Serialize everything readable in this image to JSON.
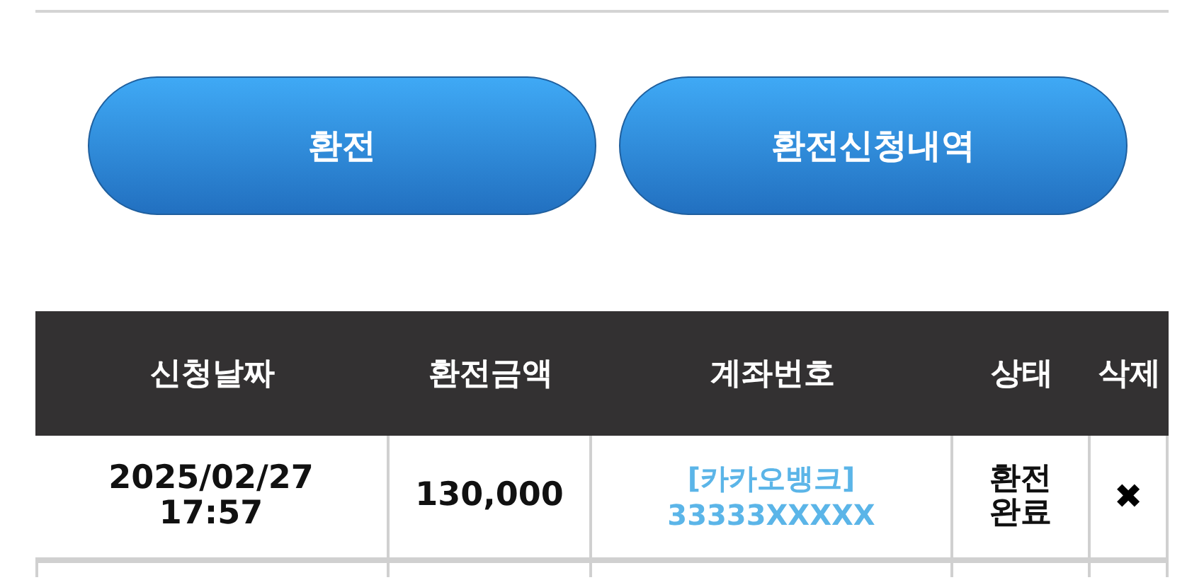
{
  "buttons": [
    {
      "label": "환전"
    },
    {
      "label": "환전신청내역"
    }
  ],
  "table": {
    "columns": [
      "신청날짜",
      "환전금액",
      "계좌번호",
      "상태",
      "삭제"
    ],
    "rows": [
      {
        "date": "2025/02/27\n17:57",
        "amount": "130,000",
        "bank": "[카카오뱅크]",
        "account": "33333XXXXX",
        "status": "환전\n완료",
        "delete": "✖"
      }
    ]
  }
}
